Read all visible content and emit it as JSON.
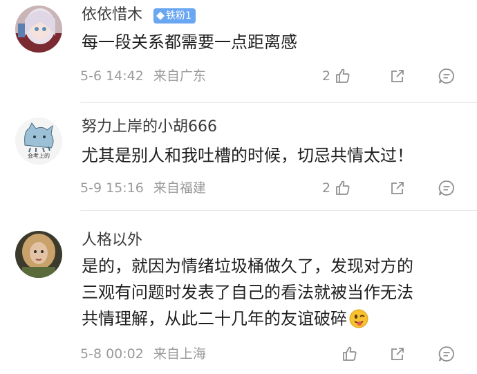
{
  "comments": [
    {
      "username": "依依惜木",
      "badge": "铁粉1",
      "text": [
        "每一段关系都需要一点距离感"
      ],
      "date": "5-6 14:42",
      "location": "来自广东",
      "likes": "2",
      "avatar_icon": "anime-girl-avatar"
    },
    {
      "username": "努力上岸的小胡666",
      "text": [
        "尤其是别人和我吐槽的时候，切忌共情太过！"
      ],
      "date": "5-9 15:16",
      "location": "来自福建",
      "likes": "2",
      "avatar_label": "会考上的",
      "avatar_icon": "cartoon-cat-avatar"
    },
    {
      "username": "人格以外",
      "text": [
        "是的，就因为情绪垃圾桶做久了，发现对方的",
        "三观有问题时发表了自己的看法就被当作无法",
        "共情理解，从此二十几年的友谊破碎"
      ],
      "date": "5-8 00:02",
      "location": "来自上海",
      "likes": "",
      "avatar_icon": "woman-photo-avatar",
      "inline_emoji": "tongue-out-emoji"
    }
  ],
  "colors": {
    "badge": "#6aa7f2",
    "meta_text": "#9a9a9a",
    "icon": "#8f8f8f"
  },
  "icons": [
    "like-icon",
    "share-icon",
    "comment-icon"
  ]
}
